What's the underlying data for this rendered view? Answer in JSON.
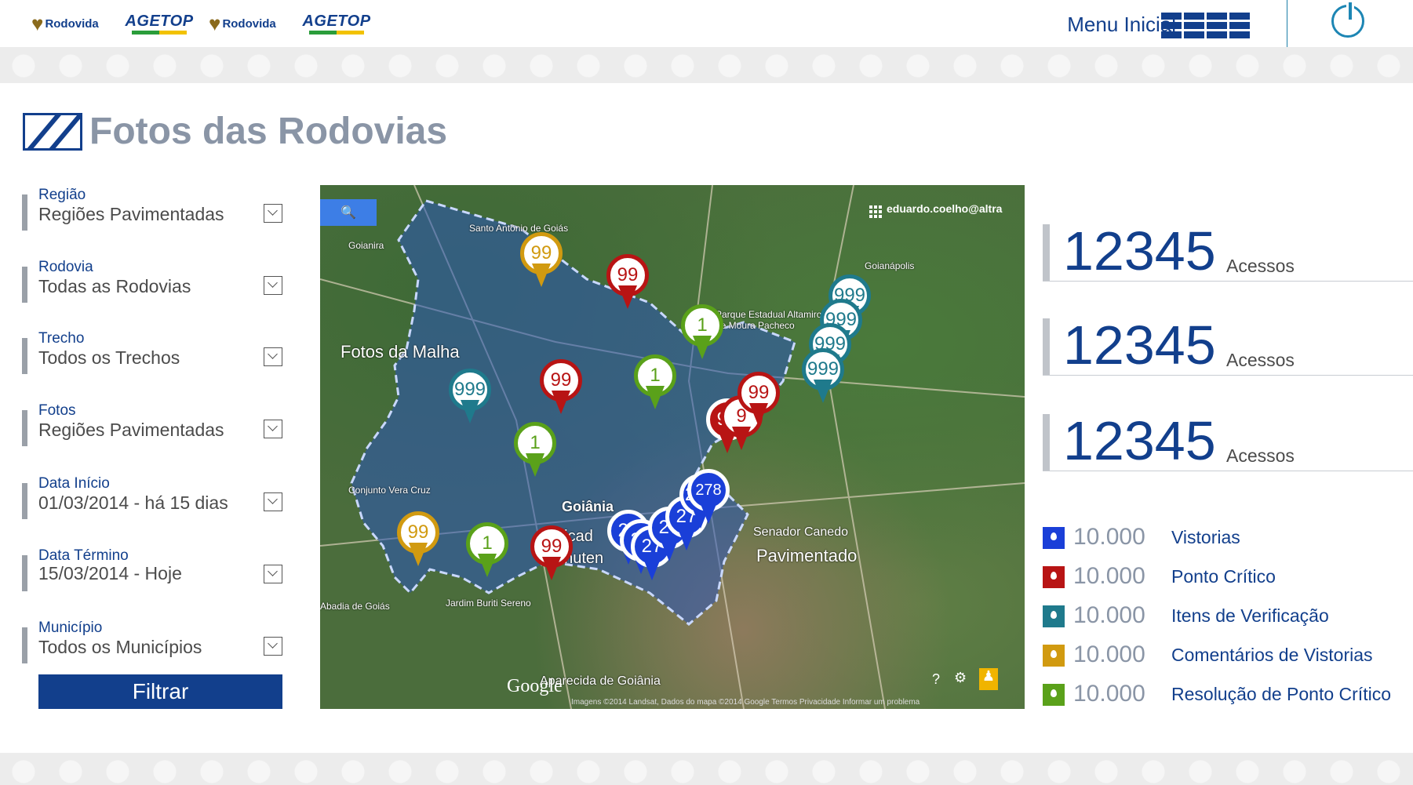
{
  "header": {
    "logos": [
      "Rodovida",
      "AGETOP",
      "Rodovida",
      "AGETOP"
    ],
    "menu_label": "Menu Inicial",
    "power_icon": "power-icon"
  },
  "page": {
    "title": "Fotos das Rodovias"
  },
  "filters": [
    {
      "label": "Região",
      "value": "Regiões Pavimentadas"
    },
    {
      "label": "Rodovia",
      "value": "Todas as Rodovias"
    },
    {
      "label": "Trecho",
      "value": "Todos os Trechos"
    },
    {
      "label": "Fotos",
      "value": "Regiões Pavimentadas"
    },
    {
      "label": "Data Início",
      "value": "01/03/2014 - há 15 dias"
    },
    {
      "label": "Data Término",
      "value": "15/03/2014 - Hoje"
    },
    {
      "label": "Município",
      "value": "Todos os Municípios"
    }
  ],
  "filter_button": "Filtrar",
  "map": {
    "user": "eduardo.coelho@altra",
    "labels": {
      "fotos_malha": "Fotos da Malha",
      "goiania": "Goiânia",
      "santo_antonio": "Santo Antônio de Goiás",
      "goianira": "Goianira",
      "goianapolis": "Goianápolis",
      "parque": "Parque Estadual Altamiro de Moura Pacheco",
      "senador": "Senador Canedo",
      "pavimentado": "Pavimentado",
      "vera_cruz": "Conjunto Vera Cruz",
      "abadia": "Abadia de Goiás",
      "jardim": "Jardim Buriti Sereno",
      "aparecida": "Aparecida de Goiânia",
      "anuten": "dicad anuten"
    },
    "footer": "Imagens ©2014 Landsat, Dados do mapa ©2014 Google   Termos   Privacidade   Informar um problema",
    "google": "Google",
    "markers": {
      "pin1": "99",
      "pin2": "99",
      "pin3": "1",
      "pin4": "999",
      "pin5": "999",
      "pin6": "999",
      "pin7": "999",
      "pin8": "999",
      "pin9": "99",
      "pin10": "1",
      "pin11": "99",
      "pin12": "1",
      "pin13": "99",
      "pin14": "1",
      "pin15": "99",
      "pin16": "278",
      "pin17": "27"
    }
  },
  "stats": [
    {
      "value": "12345",
      "unit": "Acessos"
    },
    {
      "value": "12345",
      "unit": "Acessos"
    },
    {
      "value": "12345",
      "unit": "Acessos"
    }
  ],
  "legend": [
    {
      "count": "10.000",
      "name": "Vistorias",
      "color": "#1a3fd8"
    },
    {
      "count": "10.000",
      "name": "Ponto Crítico",
      "color": "#b81414"
    },
    {
      "count": "10.000",
      "name": "Itens de Verificação",
      "color": "#1f7a8c"
    },
    {
      "count": "10.000",
      "name": "Comentários de Vistorias",
      "color": "#d19a10"
    },
    {
      "count": "10.000",
      "name": "Resolução de Ponto Crítico",
      "color": "#5aa11a"
    }
  ]
}
